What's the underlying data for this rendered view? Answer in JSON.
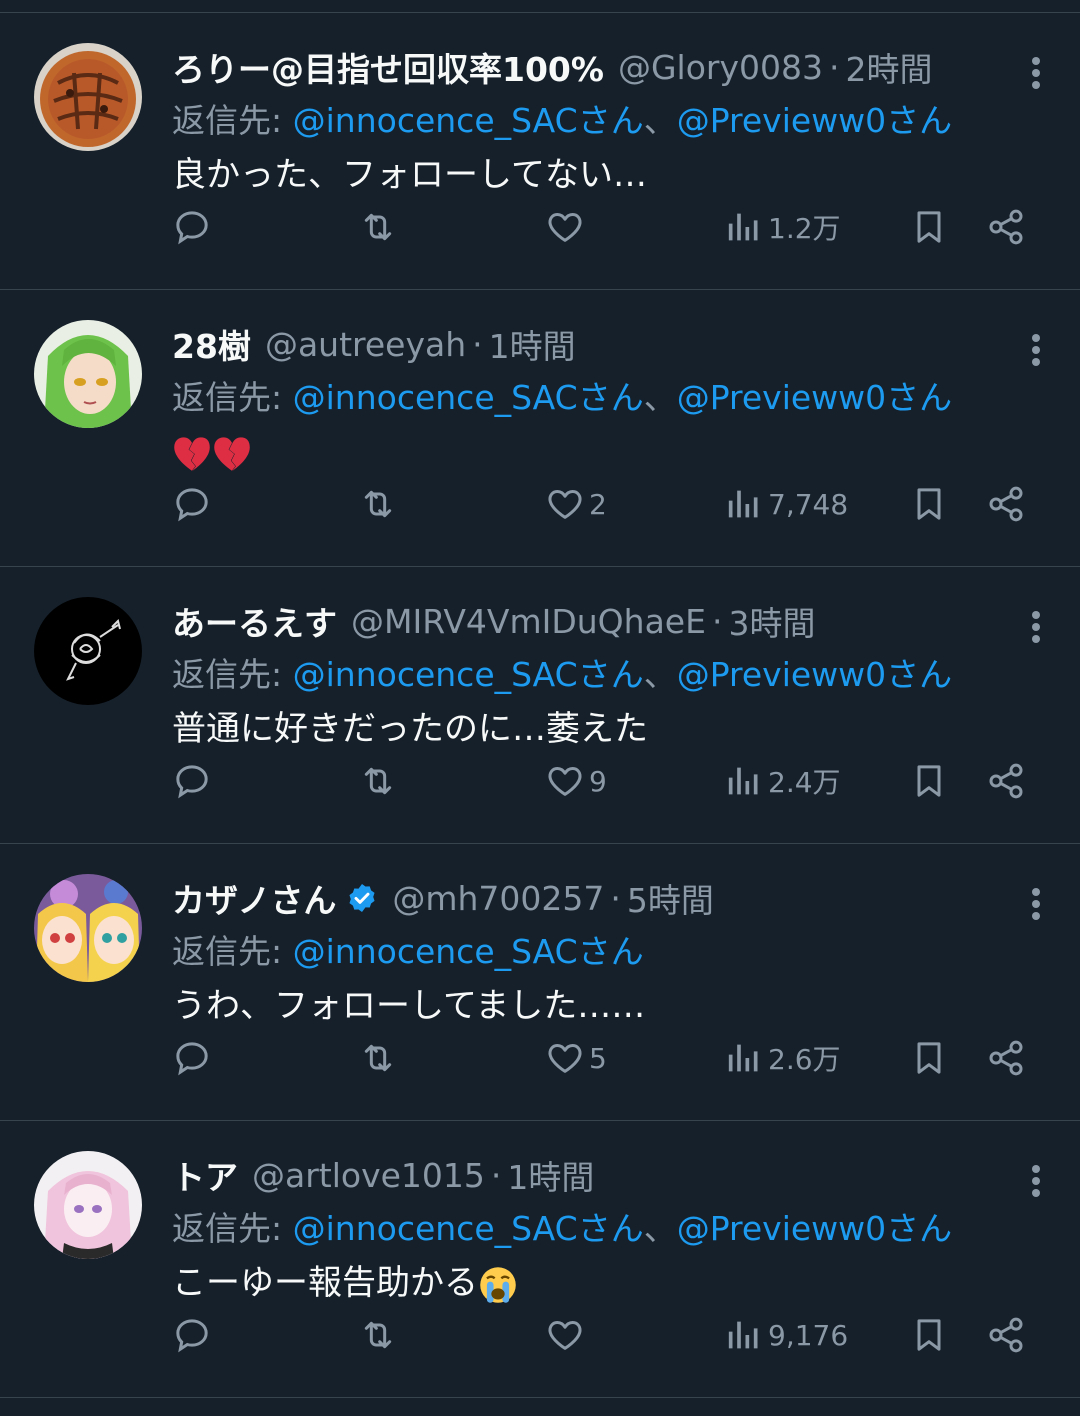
{
  "reply_prefix": "返信先:",
  "colors": {
    "background": "#15202b",
    "divider": "#38444d",
    "muted": "#8b98a5",
    "accent": "#1d9bf0"
  },
  "tweets": [
    {
      "name": "ろりー@目指せ回収率100%",
      "handle": "@Glory0083",
      "time": "2時間",
      "verified": false,
      "reply_to": [
        "@innocence_SACさん",
        "@Previeww0さん"
      ],
      "text": "良かった、フォローしてない…",
      "likes": "",
      "views": "1.2万",
      "avatar_icon": "cookie-avatar"
    },
    {
      "name": "28樹",
      "handle": "@autreeyah",
      "time": "1時間",
      "verified": false,
      "reply_to": [
        "@innocence_SACさん",
        "@Previeww0さん"
      ],
      "text": "",
      "emoji": [
        "broken-heart-icon",
        "broken-heart-icon"
      ],
      "likes": "2",
      "views": "7,748",
      "avatar_icon": "green-hair-character-avatar"
    },
    {
      "name": "あーるえす",
      "handle": "@MIRV4VmIDuQhaeE",
      "time": "3時間",
      "verified": false,
      "reply_to": [
        "@innocence_SACさん",
        "@Previeww0さん"
      ],
      "text": "普通に好きだったのに…萎えた",
      "likes": "9",
      "views": "2.4万",
      "avatar_icon": "rose-avatar"
    },
    {
      "name": "カザノさん",
      "handle": "@mh700257",
      "time": "5時間",
      "verified": true,
      "reply_to": [
        "@innocence_SACさん"
      ],
      "text": "うわ、フォローしてました……",
      "likes": "5",
      "views": "2.6万",
      "avatar_icon": "twin-girls-avatar"
    },
    {
      "name": "トア",
      "handle": "@artlove1015",
      "time": "1時間",
      "verified": false,
      "reply_to": [
        "@innocence_SACさん",
        "@Previeww0さん"
      ],
      "text": "こーゆー報告助かる",
      "emoji": [
        "crying-face-icon"
      ],
      "likes": "",
      "views": "9,176",
      "avatar_icon": "pink-hair-character-avatar"
    }
  ]
}
